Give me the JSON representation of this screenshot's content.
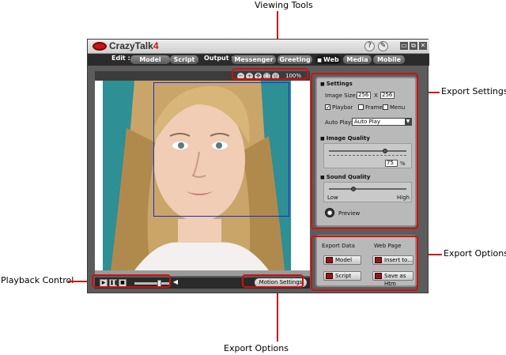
{
  "callouts": {
    "viewing_tools": "Viewing Tools",
    "export_settings": "Export Settings",
    "export_options_right": "Export Options",
    "playback_control": "Playback Control",
    "export_options_bottom": "Export Options"
  },
  "app": {
    "logo": "CrazyTalk",
    "logo_version": "4",
    "help_icon": "?",
    "window_buttons": [
      "▭",
      "⧉",
      "✕"
    ]
  },
  "tabs": {
    "edit_label": "Edit :",
    "edit_items": [
      "Model",
      "Script"
    ],
    "output_label": "Output :",
    "output_items": [
      "Messenger",
      "Greeting",
      "Web",
      "Media",
      "Mobile"
    ],
    "active": "Web"
  },
  "viewer": {
    "zoom": "100%",
    "tool_icons": [
      "zoom-out-icon",
      "zoom-in-icon",
      "pan-icon",
      "fit-icon",
      "reset-icon"
    ]
  },
  "playback": {
    "volume": 0.72,
    "motion_settings": "Motion Settings"
  },
  "settings": {
    "title": "Settings",
    "image_size_label": "Image Size:",
    "width": "256",
    "x_sep": "X",
    "height": "256",
    "playbar": "Playbar",
    "frame": "Frame",
    "menu": "Menu",
    "playbar_checked": true,
    "frame_checked": false,
    "menu_checked": false,
    "auto_play_label": "Auto Play:",
    "auto_play_value": "Auto Play",
    "image_quality_title": "Image Quality",
    "image_quality_value": "75",
    "image_quality_unit": "%",
    "sound_quality_title": "Sound Quality",
    "sound_low": "Low",
    "sound_high": "High",
    "sound_level": 0.35,
    "preview": "Preview"
  },
  "output_panel": {
    "export_data_label": "Export Data",
    "web_page_label": "Web Page",
    "model_button": "Model",
    "script_button": "Script",
    "insert_button": "Insert to...",
    "save_button": "Save as Htm"
  },
  "colors": {
    "highlight": "#d01010",
    "window_bg": "#5c5c5c",
    "panel_bg": "#b9b9b9",
    "face_box": "#1a2bd0",
    "photo_bg": "#2f8f93"
  }
}
